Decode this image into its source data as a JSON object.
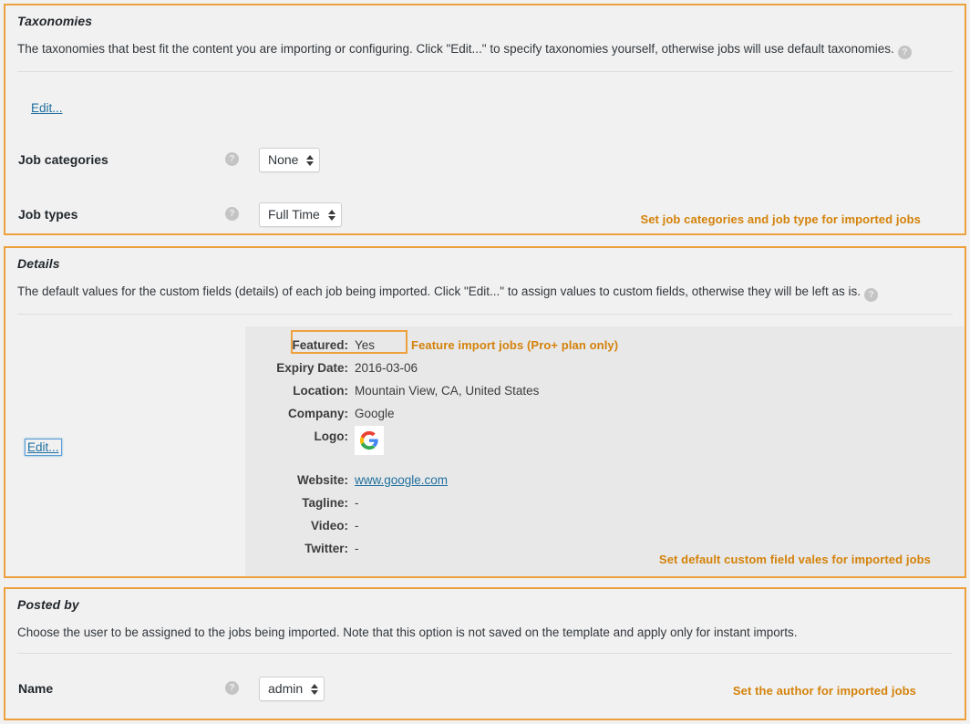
{
  "taxonomies": {
    "title": "Taxonomies",
    "description": "The taxonomies that best fit the content you are importing or configuring. Click \"Edit...\" to specify taxonomies yourself, otherwise jobs will use default taxonomies.",
    "help_glyph": "?",
    "edit_label": "Edit...",
    "rows": [
      {
        "label": "Job categories",
        "value": "None"
      },
      {
        "label": "Job types",
        "value": "Full Time"
      }
    ],
    "annotation": "Set job categories and job type for imported jobs"
  },
  "details": {
    "title": "Details",
    "description": "The default values for the custom fields (details) of each job being imported. Click \"Edit...\" to assign values to custom fields, otherwise they will be left as is.",
    "help_glyph": "?",
    "edit_label": "Edit...",
    "fields": [
      {
        "label": "Featured:",
        "value": "Yes"
      },
      {
        "label": "Expiry Date:",
        "value": "2016-03-06"
      },
      {
        "label": "Location:",
        "value": "Mountain View, CA, United States"
      },
      {
        "label": "Company:",
        "value": "Google"
      },
      {
        "label": "Logo:",
        "value": "google-logo"
      },
      {
        "label": "Website:",
        "value": "www.google.com"
      },
      {
        "label": "Tagline:",
        "value": "-"
      },
      {
        "label": "Video:",
        "value": "-"
      },
      {
        "label": "Twitter:",
        "value": "-"
      }
    ],
    "featured_annotation": "Feature import jobs (Pro+ plan only)",
    "annotation": "Set default custom field vales for imported jobs"
  },
  "posted_by": {
    "title": "Posted by",
    "description": "Choose the user to be assigned to the jobs being imported. Note that this option is not saved on the template and apply only for instant imports.",
    "help_glyph": "?",
    "rows": [
      {
        "label": "Name",
        "value": "admin"
      }
    ],
    "annotation": "Set the author for imported jobs"
  },
  "colors": {
    "accent": "#eda13d",
    "annotation_text": "#d4820a",
    "link": "#1f6f9e",
    "panel_bg": "#f1f1f1",
    "detail_bg": "#e8e8e8"
  }
}
